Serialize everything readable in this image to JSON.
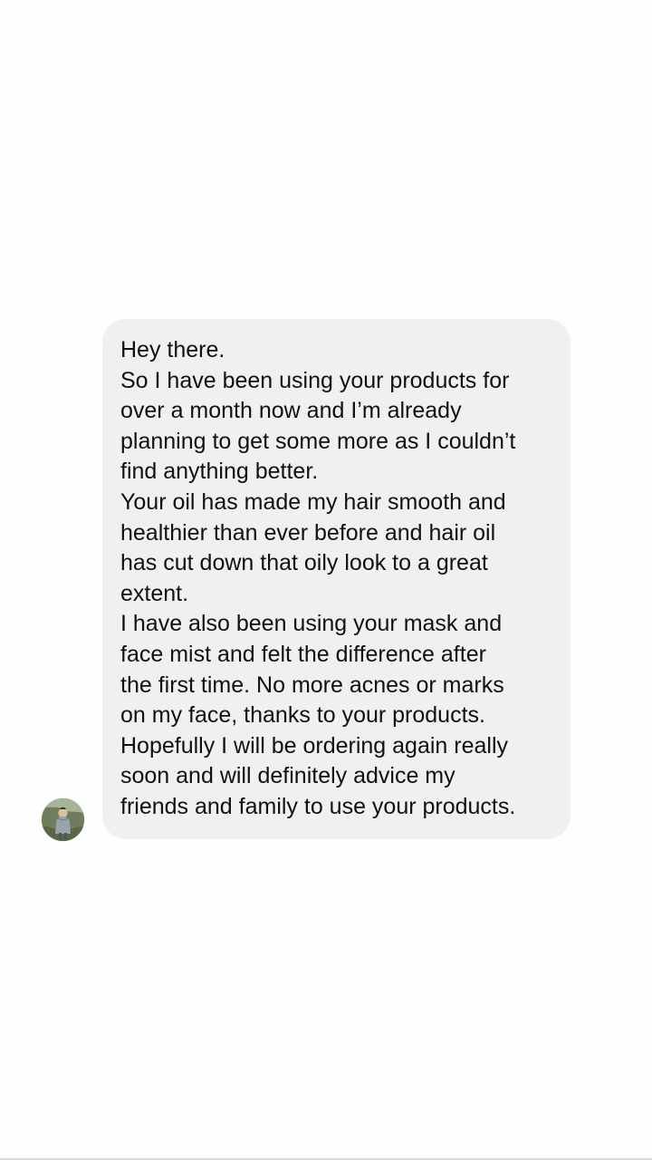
{
  "conversation": {
    "message": {
      "paragraphs": [
        "Hey there.",
        "So I have been using your products for\nover a month now and I’m already\nplanning to get some more as I couldn’t\nfind anything better.",
        "Your oil has made my hair smooth and\nhealthier than ever before and hair oil\nhas cut down that oily look to a great\nextent.",
        "I have also been using your mask and\nface mist and felt the difference after\nthe first time. No more acnes or marks\non my face, thanks to your products.",
        "Hopefully I will be ordering again really\nsoon and will definitely advice my\nfriends and family to use your products."
      ]
    },
    "avatar": {
      "icon": "user-avatar-photo"
    }
  },
  "colors": {
    "background": "#fefefe",
    "bubble": "#f0f0f2",
    "text": "#111111"
  }
}
